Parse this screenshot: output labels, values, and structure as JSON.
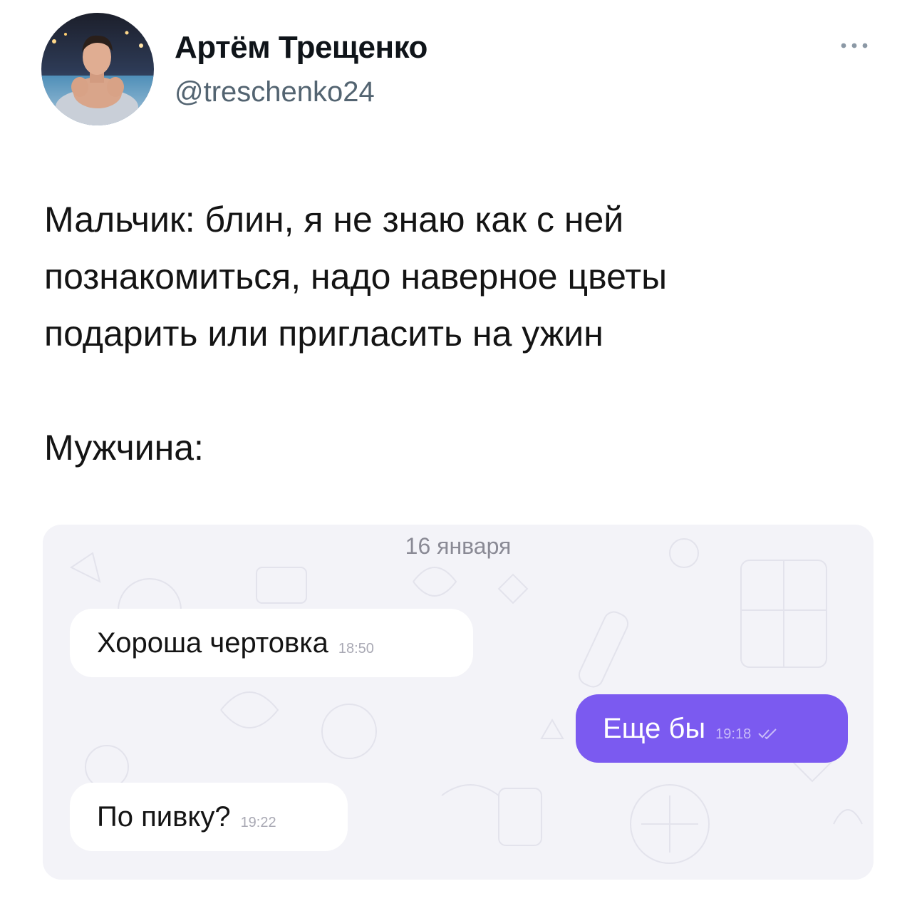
{
  "author": {
    "name": "Артём Трещенко",
    "handle": "@treschenko24"
  },
  "tweet": {
    "paragraph_1": "Мальчик: блин, я не знаю как с ней\nпознакомиться, надо наверное цветы\nподарить или пригласить на ужин",
    "paragraph_2": "Мужчина:"
  },
  "chat": {
    "date": "16 января",
    "messages": [
      {
        "direction": "incoming",
        "text": "Хороша чертовка",
        "time": "18:50"
      },
      {
        "direction": "outgoing",
        "text": "Еще бы",
        "time": "19:18",
        "status": "read"
      },
      {
        "direction": "incoming",
        "text": "По пивку?",
        "time": "19:22"
      }
    ]
  },
  "icons": {
    "more": "more-horizontal-icon",
    "read_status": "double-check-icon"
  },
  "colors": {
    "outgoing_bubble": "#7b5af0",
    "incoming_bubble": "#ffffff",
    "chat_background": "#f3f3f8",
    "handle_text": "#536471"
  }
}
